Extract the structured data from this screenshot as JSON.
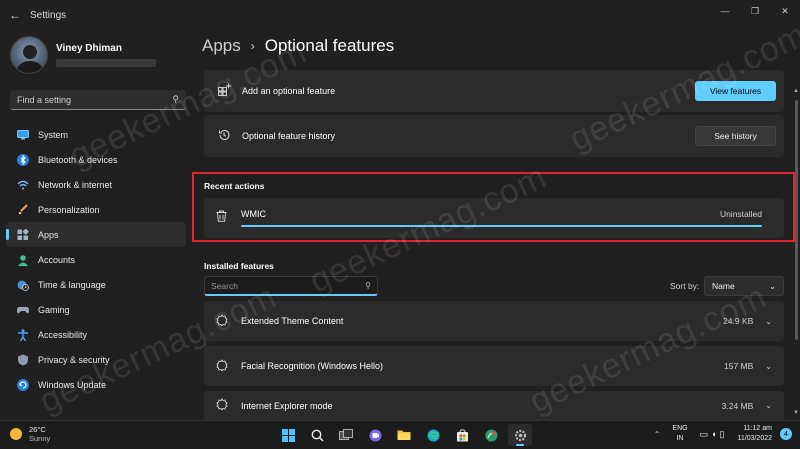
{
  "window": {
    "title": "Settings"
  },
  "profile": {
    "name": "Viney Dhiman"
  },
  "sidebar": {
    "search_placeholder": "Find a setting",
    "items": [
      {
        "label": "System",
        "icon": "monitor-icon",
        "active": false
      },
      {
        "label": "Bluetooth & devices",
        "icon": "bluetooth-icon",
        "active": false
      },
      {
        "label": "Network & internet",
        "icon": "wifi-icon",
        "active": false
      },
      {
        "label": "Personalization",
        "icon": "brush-icon",
        "active": false
      },
      {
        "label": "Apps",
        "icon": "apps-icon",
        "active": true
      },
      {
        "label": "Accounts",
        "icon": "person-icon",
        "active": false
      },
      {
        "label": "Time & language",
        "icon": "globe-clock-icon",
        "active": false
      },
      {
        "label": "Gaming",
        "icon": "gamepad-icon",
        "active": false
      },
      {
        "label": "Accessibility",
        "icon": "accessibility-icon",
        "active": false
      },
      {
        "label": "Privacy & security",
        "icon": "shield-icon",
        "active": false
      },
      {
        "label": "Windows Update",
        "icon": "update-icon",
        "active": false
      }
    ]
  },
  "breadcrumb": {
    "parent": "Apps",
    "current": "Optional features"
  },
  "cards": {
    "add": {
      "label": "Add an optional feature",
      "button": "View features"
    },
    "history": {
      "label": "Optional feature history",
      "button": "See history"
    }
  },
  "recent": {
    "heading": "Recent actions",
    "item": {
      "name": "WMIC",
      "status": "Uninstalled",
      "progress": 100
    }
  },
  "installed": {
    "heading": "Installed features",
    "search_placeholder": "Search",
    "sort_label": "Sort by:",
    "sort_value": "Name",
    "features": [
      {
        "name": "Extended Theme Content",
        "size": "24.9 KB"
      },
      {
        "name": "Facial Recognition (Windows Hello)",
        "size": "157 MB"
      },
      {
        "name": "Internet Explorer mode",
        "size": "3.24 MB"
      }
    ]
  },
  "watermark": "geekermag.com",
  "taskbar": {
    "weather_temp": "26°C",
    "weather_desc": "Sunny",
    "lang_line1": "ENG",
    "lang_line2": "IN",
    "time": "11:12 am",
    "date": "11/03/2022",
    "notifications": "4"
  },
  "colors": {
    "accent": "#60cdff",
    "highlight": "#e0262e",
    "background": "#202020",
    "card": "#2b2b2b"
  }
}
